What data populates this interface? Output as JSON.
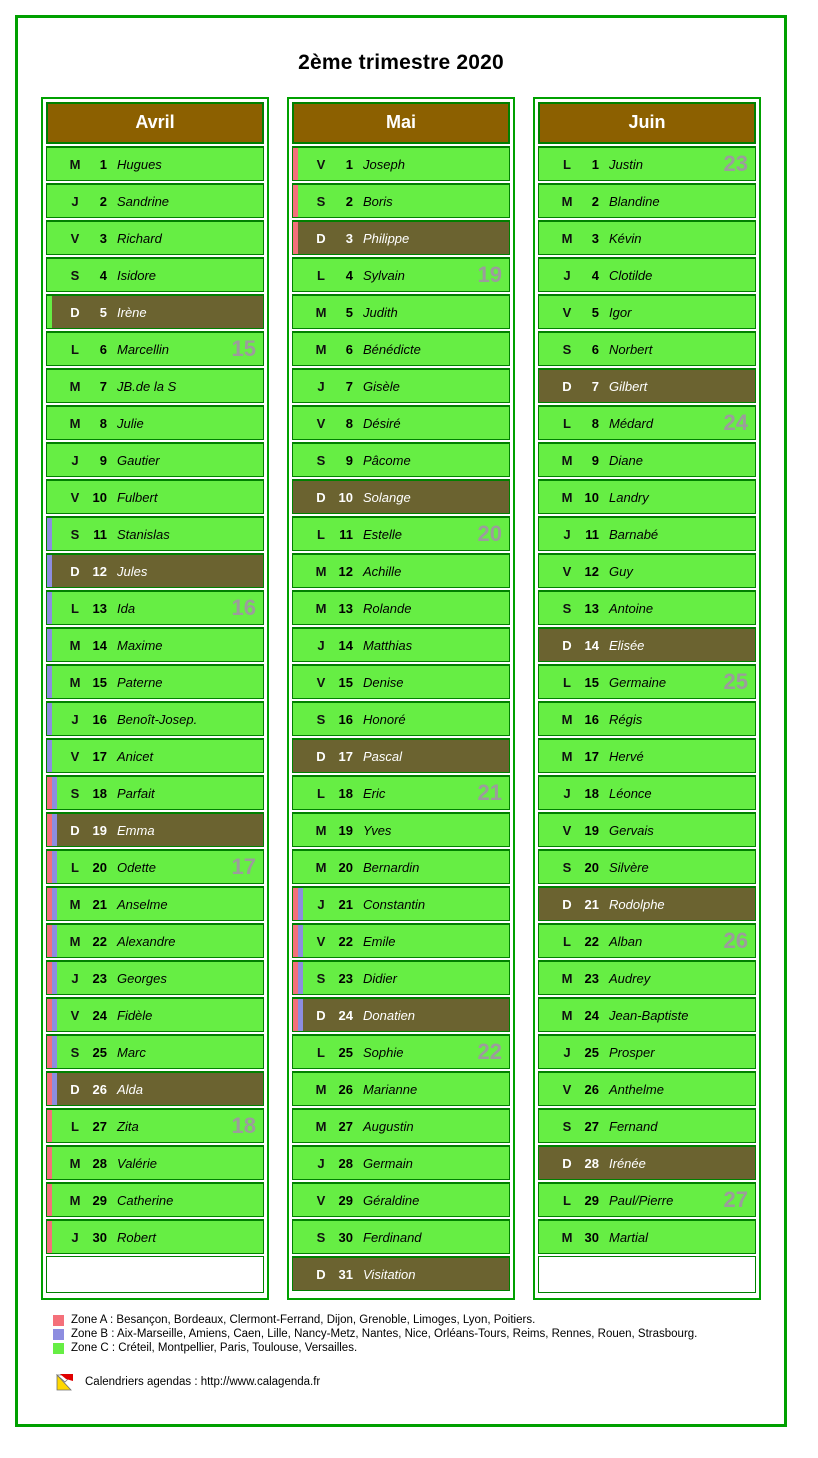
{
  "title": "2ème trimestre 2020",
  "colors": {
    "frame": "#00a000",
    "header_bg": "#8c6000",
    "weekday_bg": "#66ee44",
    "sunday_bg": "#6b6330",
    "week_number": "#9c9c9c",
    "zone_a": "#f4707a",
    "zone_b": "#8d8de0",
    "zone_c": "#66ee44"
  },
  "months": [
    {
      "name": "Avril",
      "days": [
        {
          "dow": "M",
          "num": "1",
          "saint": "Hugues",
          "sunday": false,
          "week": "",
          "zones": []
        },
        {
          "dow": "J",
          "num": "2",
          "saint": "Sandrine",
          "sunday": false,
          "week": "",
          "zones": []
        },
        {
          "dow": "V",
          "num": "3",
          "saint": "Richard",
          "sunday": false,
          "week": "",
          "zones": []
        },
        {
          "dow": "S",
          "num": "4",
          "saint": "Isidore",
          "sunday": false,
          "week": "",
          "zones": []
        },
        {
          "dow": "D",
          "num": "5",
          "saint": "Irène",
          "sunday": true,
          "week": "",
          "zones": [
            "C"
          ]
        },
        {
          "dow": "L",
          "num": "6",
          "saint": "Marcellin",
          "sunday": false,
          "week": "15",
          "zones": [
            "C"
          ]
        },
        {
          "dow": "M",
          "num": "7",
          "saint": "JB.de la S",
          "sunday": false,
          "week": "",
          "zones": [
            "C"
          ]
        },
        {
          "dow": "M",
          "num": "8",
          "saint": "Julie",
          "sunday": false,
          "week": "",
          "zones": [
            "C"
          ]
        },
        {
          "dow": "J",
          "num": "9",
          "saint": "Gautier",
          "sunday": false,
          "week": "",
          "zones": [
            "C"
          ]
        },
        {
          "dow": "V",
          "num": "10",
          "saint": "Fulbert",
          "sunday": false,
          "week": "",
          "zones": [
            "C"
          ]
        },
        {
          "dow": "S",
          "num": "11",
          "saint": "Stanislas",
          "sunday": false,
          "week": "",
          "zones": [
            "B"
          ]
        },
        {
          "dow": "D",
          "num": "12",
          "saint": "Jules",
          "sunday": true,
          "week": "",
          "zones": [
            "B"
          ]
        },
        {
          "dow": "L",
          "num": "13",
          "saint": "Ida",
          "sunday": false,
          "week": "16",
          "zones": [
            "B"
          ]
        },
        {
          "dow": "M",
          "num": "14",
          "saint": "Maxime",
          "sunday": false,
          "week": "",
          "zones": [
            "B"
          ]
        },
        {
          "dow": "M",
          "num": "15",
          "saint": "Paterne",
          "sunday": false,
          "week": "",
          "zones": [
            "B"
          ]
        },
        {
          "dow": "J",
          "num": "16",
          "saint": "Benoît-Josep.",
          "sunday": false,
          "week": "",
          "zones": [
            "B"
          ]
        },
        {
          "dow": "V",
          "num": "17",
          "saint": "Anicet",
          "sunday": false,
          "week": "",
          "zones": [
            "B"
          ]
        },
        {
          "dow": "S",
          "num": "18",
          "saint": "Parfait",
          "sunday": false,
          "week": "",
          "zones": [
            "A",
            "B"
          ]
        },
        {
          "dow": "D",
          "num": "19",
          "saint": "Emma",
          "sunday": true,
          "week": "",
          "zones": [
            "A",
            "B"
          ]
        },
        {
          "dow": "L",
          "num": "20",
          "saint": "Odette",
          "sunday": false,
          "week": "17",
          "zones": [
            "A",
            "B"
          ]
        },
        {
          "dow": "M",
          "num": "21",
          "saint": "Anselme",
          "sunday": false,
          "week": "",
          "zones": [
            "A",
            "B"
          ]
        },
        {
          "dow": "M",
          "num": "22",
          "saint": "Alexandre",
          "sunday": false,
          "week": "",
          "zones": [
            "A",
            "B"
          ]
        },
        {
          "dow": "J",
          "num": "23",
          "saint": "Georges",
          "sunday": false,
          "week": "",
          "zones": [
            "A",
            "B"
          ]
        },
        {
          "dow": "V",
          "num": "24",
          "saint": "Fidèle",
          "sunday": false,
          "week": "",
          "zones": [
            "A",
            "B"
          ]
        },
        {
          "dow": "S",
          "num": "25",
          "saint": "Marc",
          "sunday": false,
          "week": "",
          "zones": [
            "A",
            "B"
          ]
        },
        {
          "dow": "D",
          "num": "26",
          "saint": "Alda",
          "sunday": true,
          "week": "",
          "zones": [
            "A",
            "B"
          ]
        },
        {
          "dow": "L",
          "num": "27",
          "saint": "Zita",
          "sunday": false,
          "week": "18",
          "zones": [
            "A"
          ]
        },
        {
          "dow": "M",
          "num": "28",
          "saint": "Valérie",
          "sunday": false,
          "week": "",
          "zones": [
            "A"
          ]
        },
        {
          "dow": "M",
          "num": "29",
          "saint": "Catherine",
          "sunday": false,
          "week": "",
          "zones": [
            "A"
          ]
        },
        {
          "dow": "J",
          "num": "30",
          "saint": "Robert",
          "sunday": false,
          "week": "",
          "zones": [
            "A"
          ]
        }
      ],
      "filler": 1
    },
    {
      "name": "Mai",
      "days": [
        {
          "dow": "V",
          "num": "1",
          "saint": "Joseph",
          "sunday": false,
          "week": "",
          "zones": [
            "A"
          ]
        },
        {
          "dow": "S",
          "num": "2",
          "saint": "Boris",
          "sunday": false,
          "week": "",
          "zones": [
            "A"
          ]
        },
        {
          "dow": "D",
          "num": "3",
          "saint": "Philippe",
          "sunday": true,
          "week": "",
          "zones": [
            "A"
          ]
        },
        {
          "dow": "L",
          "num": "4",
          "saint": "Sylvain",
          "sunday": false,
          "week": "19",
          "zones": []
        },
        {
          "dow": "M",
          "num": "5",
          "saint": "Judith",
          "sunday": false,
          "week": "",
          "zones": []
        },
        {
          "dow": "M",
          "num": "6",
          "saint": "Bénédicte",
          "sunday": false,
          "week": "",
          "zones": []
        },
        {
          "dow": "J",
          "num": "7",
          "saint": "Gisèle",
          "sunday": false,
          "week": "",
          "zones": []
        },
        {
          "dow": "V",
          "num": "8",
          "saint": "Désiré",
          "sunday": false,
          "week": "",
          "zones": []
        },
        {
          "dow": "S",
          "num": "9",
          "saint": "Pâcome",
          "sunday": false,
          "week": "",
          "zones": []
        },
        {
          "dow": "D",
          "num": "10",
          "saint": "Solange",
          "sunday": true,
          "week": "",
          "zones": []
        },
        {
          "dow": "L",
          "num": "11",
          "saint": "Estelle",
          "sunday": false,
          "week": "20",
          "zones": []
        },
        {
          "dow": "M",
          "num": "12",
          "saint": "Achille",
          "sunday": false,
          "week": "",
          "zones": []
        },
        {
          "dow": "M",
          "num": "13",
          "saint": "Rolande",
          "sunday": false,
          "week": "",
          "zones": []
        },
        {
          "dow": "J",
          "num": "14",
          "saint": "Matthias",
          "sunday": false,
          "week": "",
          "zones": []
        },
        {
          "dow": "V",
          "num": "15",
          "saint": "Denise",
          "sunday": false,
          "week": "",
          "zones": []
        },
        {
          "dow": "S",
          "num": "16",
          "saint": "Honoré",
          "sunday": false,
          "week": "",
          "zones": []
        },
        {
          "dow": "D",
          "num": "17",
          "saint": "Pascal",
          "sunday": true,
          "week": "",
          "zones": []
        },
        {
          "dow": "L",
          "num": "18",
          "saint": "Eric",
          "sunday": false,
          "week": "21",
          "zones": []
        },
        {
          "dow": "M",
          "num": "19",
          "saint": "Yves",
          "sunday": false,
          "week": "",
          "zones": []
        },
        {
          "dow": "M",
          "num": "20",
          "saint": "Bernardin",
          "sunday": false,
          "week": "",
          "zones": []
        },
        {
          "dow": "J",
          "num": "21",
          "saint": "Constantin",
          "sunday": false,
          "week": "",
          "zones": [
            "A",
            "B"
          ]
        },
        {
          "dow": "V",
          "num": "22",
          "saint": "Emile",
          "sunday": false,
          "week": "",
          "zones": [
            "A",
            "B"
          ]
        },
        {
          "dow": "S",
          "num": "23",
          "saint": "Didier",
          "sunday": false,
          "week": "",
          "zones": [
            "A",
            "B"
          ]
        },
        {
          "dow": "D",
          "num": "24",
          "saint": "Donatien",
          "sunday": true,
          "week": "",
          "zones": [
            "A",
            "B"
          ]
        },
        {
          "dow": "L",
          "num": "25",
          "saint": "Sophie",
          "sunday": false,
          "week": "22",
          "zones": []
        },
        {
          "dow": "M",
          "num": "26",
          "saint": "Marianne",
          "sunday": false,
          "week": "",
          "zones": []
        },
        {
          "dow": "M",
          "num": "27",
          "saint": "Augustin",
          "sunday": false,
          "week": "",
          "zones": []
        },
        {
          "dow": "J",
          "num": "28",
          "saint": "Germain",
          "sunday": false,
          "week": "",
          "zones": []
        },
        {
          "dow": "V",
          "num": "29",
          "saint": "Géraldine",
          "sunday": false,
          "week": "",
          "zones": []
        },
        {
          "dow": "S",
          "num": "30",
          "saint": "Ferdinand",
          "sunday": false,
          "week": "",
          "zones": []
        },
        {
          "dow": "D",
          "num": "31",
          "saint": "Visitation",
          "sunday": true,
          "week": "",
          "zones": []
        }
      ],
      "filler": 0
    },
    {
      "name": "Juin",
      "days": [
        {
          "dow": "L",
          "num": "1",
          "saint": "Justin",
          "sunday": false,
          "week": "23",
          "zones": []
        },
        {
          "dow": "M",
          "num": "2",
          "saint": "Blandine",
          "sunday": false,
          "week": "",
          "zones": []
        },
        {
          "dow": "M",
          "num": "3",
          "saint": "Kévin",
          "sunday": false,
          "week": "",
          "zones": []
        },
        {
          "dow": "J",
          "num": "4",
          "saint": "Clotilde",
          "sunday": false,
          "week": "",
          "zones": []
        },
        {
          "dow": "V",
          "num": "5",
          "saint": "Igor",
          "sunday": false,
          "week": "",
          "zones": []
        },
        {
          "dow": "S",
          "num": "6",
          "saint": "Norbert",
          "sunday": false,
          "week": "",
          "zones": []
        },
        {
          "dow": "D",
          "num": "7",
          "saint": "Gilbert",
          "sunday": true,
          "week": "",
          "zones": []
        },
        {
          "dow": "L",
          "num": "8",
          "saint": "Médard",
          "sunday": false,
          "week": "24",
          "zones": []
        },
        {
          "dow": "M",
          "num": "9",
          "saint": "Diane",
          "sunday": false,
          "week": "",
          "zones": []
        },
        {
          "dow": "M",
          "num": "10",
          "saint": "Landry",
          "sunday": false,
          "week": "",
          "zones": []
        },
        {
          "dow": "J",
          "num": "11",
          "saint": "Barnabé",
          "sunday": false,
          "week": "",
          "zones": []
        },
        {
          "dow": "V",
          "num": "12",
          "saint": "Guy",
          "sunday": false,
          "week": "",
          "zones": []
        },
        {
          "dow": "S",
          "num": "13",
          "saint": "Antoine",
          "sunday": false,
          "week": "",
          "zones": []
        },
        {
          "dow": "D",
          "num": "14",
          "saint": "Elisée",
          "sunday": true,
          "week": "",
          "zones": []
        },
        {
          "dow": "L",
          "num": "15",
          "saint": "Germaine",
          "sunday": false,
          "week": "25",
          "zones": []
        },
        {
          "dow": "M",
          "num": "16",
          "saint": "Régis",
          "sunday": false,
          "week": "",
          "zones": []
        },
        {
          "dow": "M",
          "num": "17",
          "saint": "Hervé",
          "sunday": false,
          "week": "",
          "zones": []
        },
        {
          "dow": "J",
          "num": "18",
          "saint": "Léonce",
          "sunday": false,
          "week": "",
          "zones": []
        },
        {
          "dow": "V",
          "num": "19",
          "saint": "Gervais",
          "sunday": false,
          "week": "",
          "zones": []
        },
        {
          "dow": "S",
          "num": "20",
          "saint": "Silvère",
          "sunday": false,
          "week": "",
          "zones": []
        },
        {
          "dow": "D",
          "num": "21",
          "saint": "Rodolphe",
          "sunday": true,
          "week": "",
          "zones": []
        },
        {
          "dow": "L",
          "num": "22",
          "saint": "Alban",
          "sunday": false,
          "week": "26",
          "zones": []
        },
        {
          "dow": "M",
          "num": "23",
          "saint": "Audrey",
          "sunday": false,
          "week": "",
          "zones": []
        },
        {
          "dow": "M",
          "num": "24",
          "saint": "Jean-Baptiste",
          "sunday": false,
          "week": "",
          "zones": []
        },
        {
          "dow": "J",
          "num": "25",
          "saint": "Prosper",
          "sunday": false,
          "week": "",
          "zones": []
        },
        {
          "dow": "V",
          "num": "26",
          "saint": "Anthelme",
          "sunday": false,
          "week": "",
          "zones": []
        },
        {
          "dow": "S",
          "num": "27",
          "saint": "Fernand",
          "sunday": false,
          "week": "",
          "zones": []
        },
        {
          "dow": "D",
          "num": "28",
          "saint": "Irénée",
          "sunday": true,
          "week": "",
          "zones": []
        },
        {
          "dow": "L",
          "num": "29",
          "saint": "Paul/Pierre",
          "sunday": false,
          "week": "27",
          "zones": []
        },
        {
          "dow": "M",
          "num": "30",
          "saint": "Martial",
          "sunday": false,
          "week": "",
          "zones": []
        }
      ],
      "filler": 1
    }
  ],
  "legend": [
    {
      "zone": "A",
      "color": "#f4707a",
      "text": "Zone A : Besançon, Bordeaux, Clermont-Ferrand, Dijon, Grenoble, Limoges, Lyon, Poitiers."
    },
    {
      "zone": "B",
      "color": "#8d8de0",
      "text": "Zone B : Aix-Marseille, Amiens, Caen, Lille, Nancy-Metz, Nantes, Nice, Orléans-Tours, Reims, Rennes, Rouen, Strasbourg."
    },
    {
      "zone": "C",
      "color": "#66ee44",
      "text": "Zone C : Créteil, Montpellier, Paris, Toulouse, Versailles."
    }
  ],
  "footer": {
    "text": "Calendriers agendas : http://www.calagenda.fr"
  }
}
